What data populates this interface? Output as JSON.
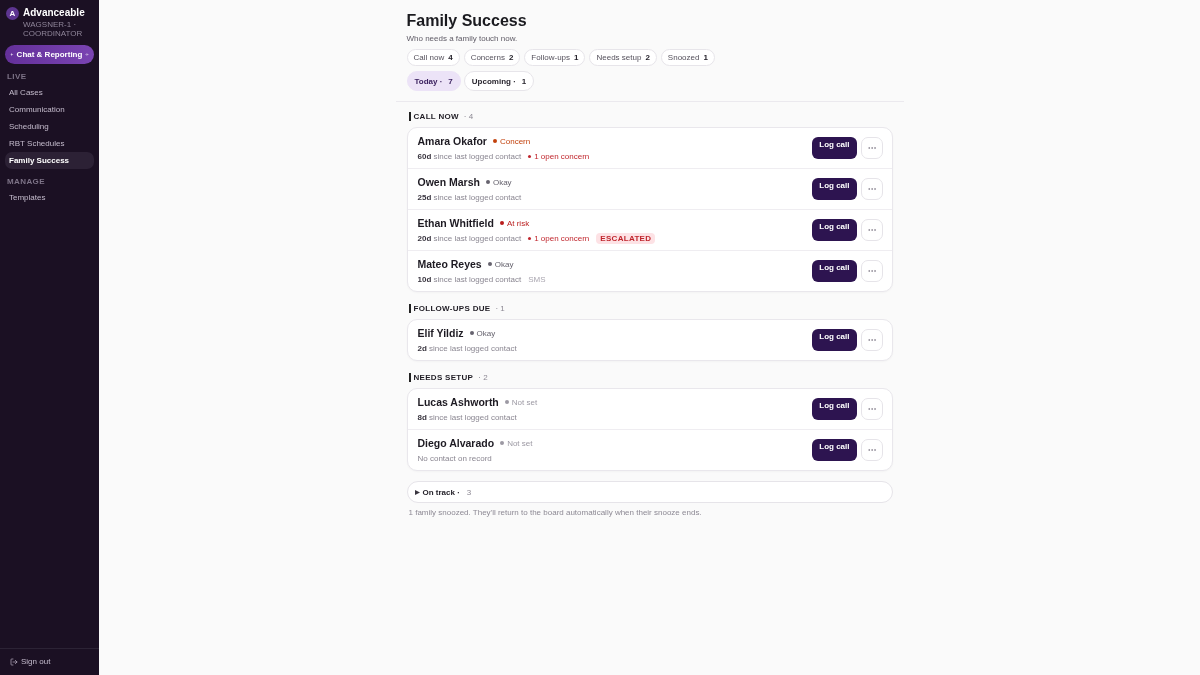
{
  "sidebar": {
    "brand": {
      "initial": "A",
      "name": "Advanceable",
      "subtitle": "WAGSNER-1 · COORDINATOR"
    },
    "chat_button": {
      "label": "Chat & Reporting"
    },
    "groups": [
      {
        "label": "LIVE",
        "items": [
          {
            "label": "All Cases",
            "selected": false
          },
          {
            "label": "Communication",
            "selected": false
          },
          {
            "label": "Scheduling",
            "selected": false
          },
          {
            "label": "RBT Schedules",
            "selected": false
          },
          {
            "label": "Family Success",
            "selected": true
          }
        ]
      },
      {
        "label": "MANAGE",
        "items": [
          {
            "label": "Templates",
            "selected": false
          }
        ]
      }
    ],
    "sign_out": {
      "label": "Sign out"
    }
  },
  "header": {
    "title": "Family Success",
    "subtitle": "Who needs a family touch now.",
    "chips": [
      {
        "label": "Call now",
        "count": "4"
      },
      {
        "label": "Concerns",
        "count": "2"
      },
      {
        "label": "Follow-ups",
        "count": "1"
      },
      {
        "label": "Needs setup",
        "count": "2"
      },
      {
        "label": "Snoozed",
        "count": "1"
      }
    ],
    "tabs": [
      {
        "label": "Today ·",
        "count": "7",
        "selected": true
      },
      {
        "label": "Upcoming ·",
        "count": "1",
        "selected": false
      }
    ]
  },
  "sections": [
    {
      "title": "CALL NOW",
      "count": "· 4",
      "families": [
        {
          "name": "Amara Okafor",
          "status": {
            "label": "Concern",
            "color": "#c2410c"
          },
          "contact": "**60d** since last logged contact",
          "concern": "1 open concern",
          "action": "Log call"
        },
        {
          "name": "Owen Marsh",
          "status": {
            "label": "Okay",
            "color": "#66636e"
          },
          "contact": "**25d** since last logged contact",
          "action": "Log call"
        },
        {
          "name": "Ethan Whitfield",
          "status": {
            "label": "At risk",
            "color": "#b91c1c"
          },
          "contact": "**20d** since last logged contact",
          "concern": "1 open concern",
          "badge": "ESCALATED",
          "action": "Log call"
        },
        {
          "name": "Mateo Reyes",
          "status": {
            "label": "Okay",
            "color": "#66636e"
          },
          "contact": "**10d** since last logged contact",
          "channel": "SMS",
          "action": "Log call"
        }
      ]
    },
    {
      "title": "FOLLOW-UPS DUE",
      "count": "· 1",
      "families": [
        {
          "name": "Elif Yildiz",
          "status": {
            "label": "Okay",
            "color": "#66636e"
          },
          "contact": "**2d** since last logged contact",
          "action": "Log call"
        }
      ]
    },
    {
      "title": "NEEDS SETUP",
      "count": "· 2",
      "families": [
        {
          "name": "Lucas Ashworth",
          "status": {
            "label": "Not set",
            "color": "#9c99a3"
          },
          "contact": "**8d** since last logged contact",
          "action": "Log call"
        },
        {
          "name": "Diego Alvarado",
          "status": {
            "label": "Not set",
            "color": "#9c99a3"
          },
          "contact": "No contact on record",
          "action": "Log call"
        }
      ]
    }
  ],
  "on_track": {
    "label": "On track ·",
    "count": "3",
    "expanded": false
  },
  "footnote": "1 family snoozed. They'll return to the board automatically when their snooze ends."
}
